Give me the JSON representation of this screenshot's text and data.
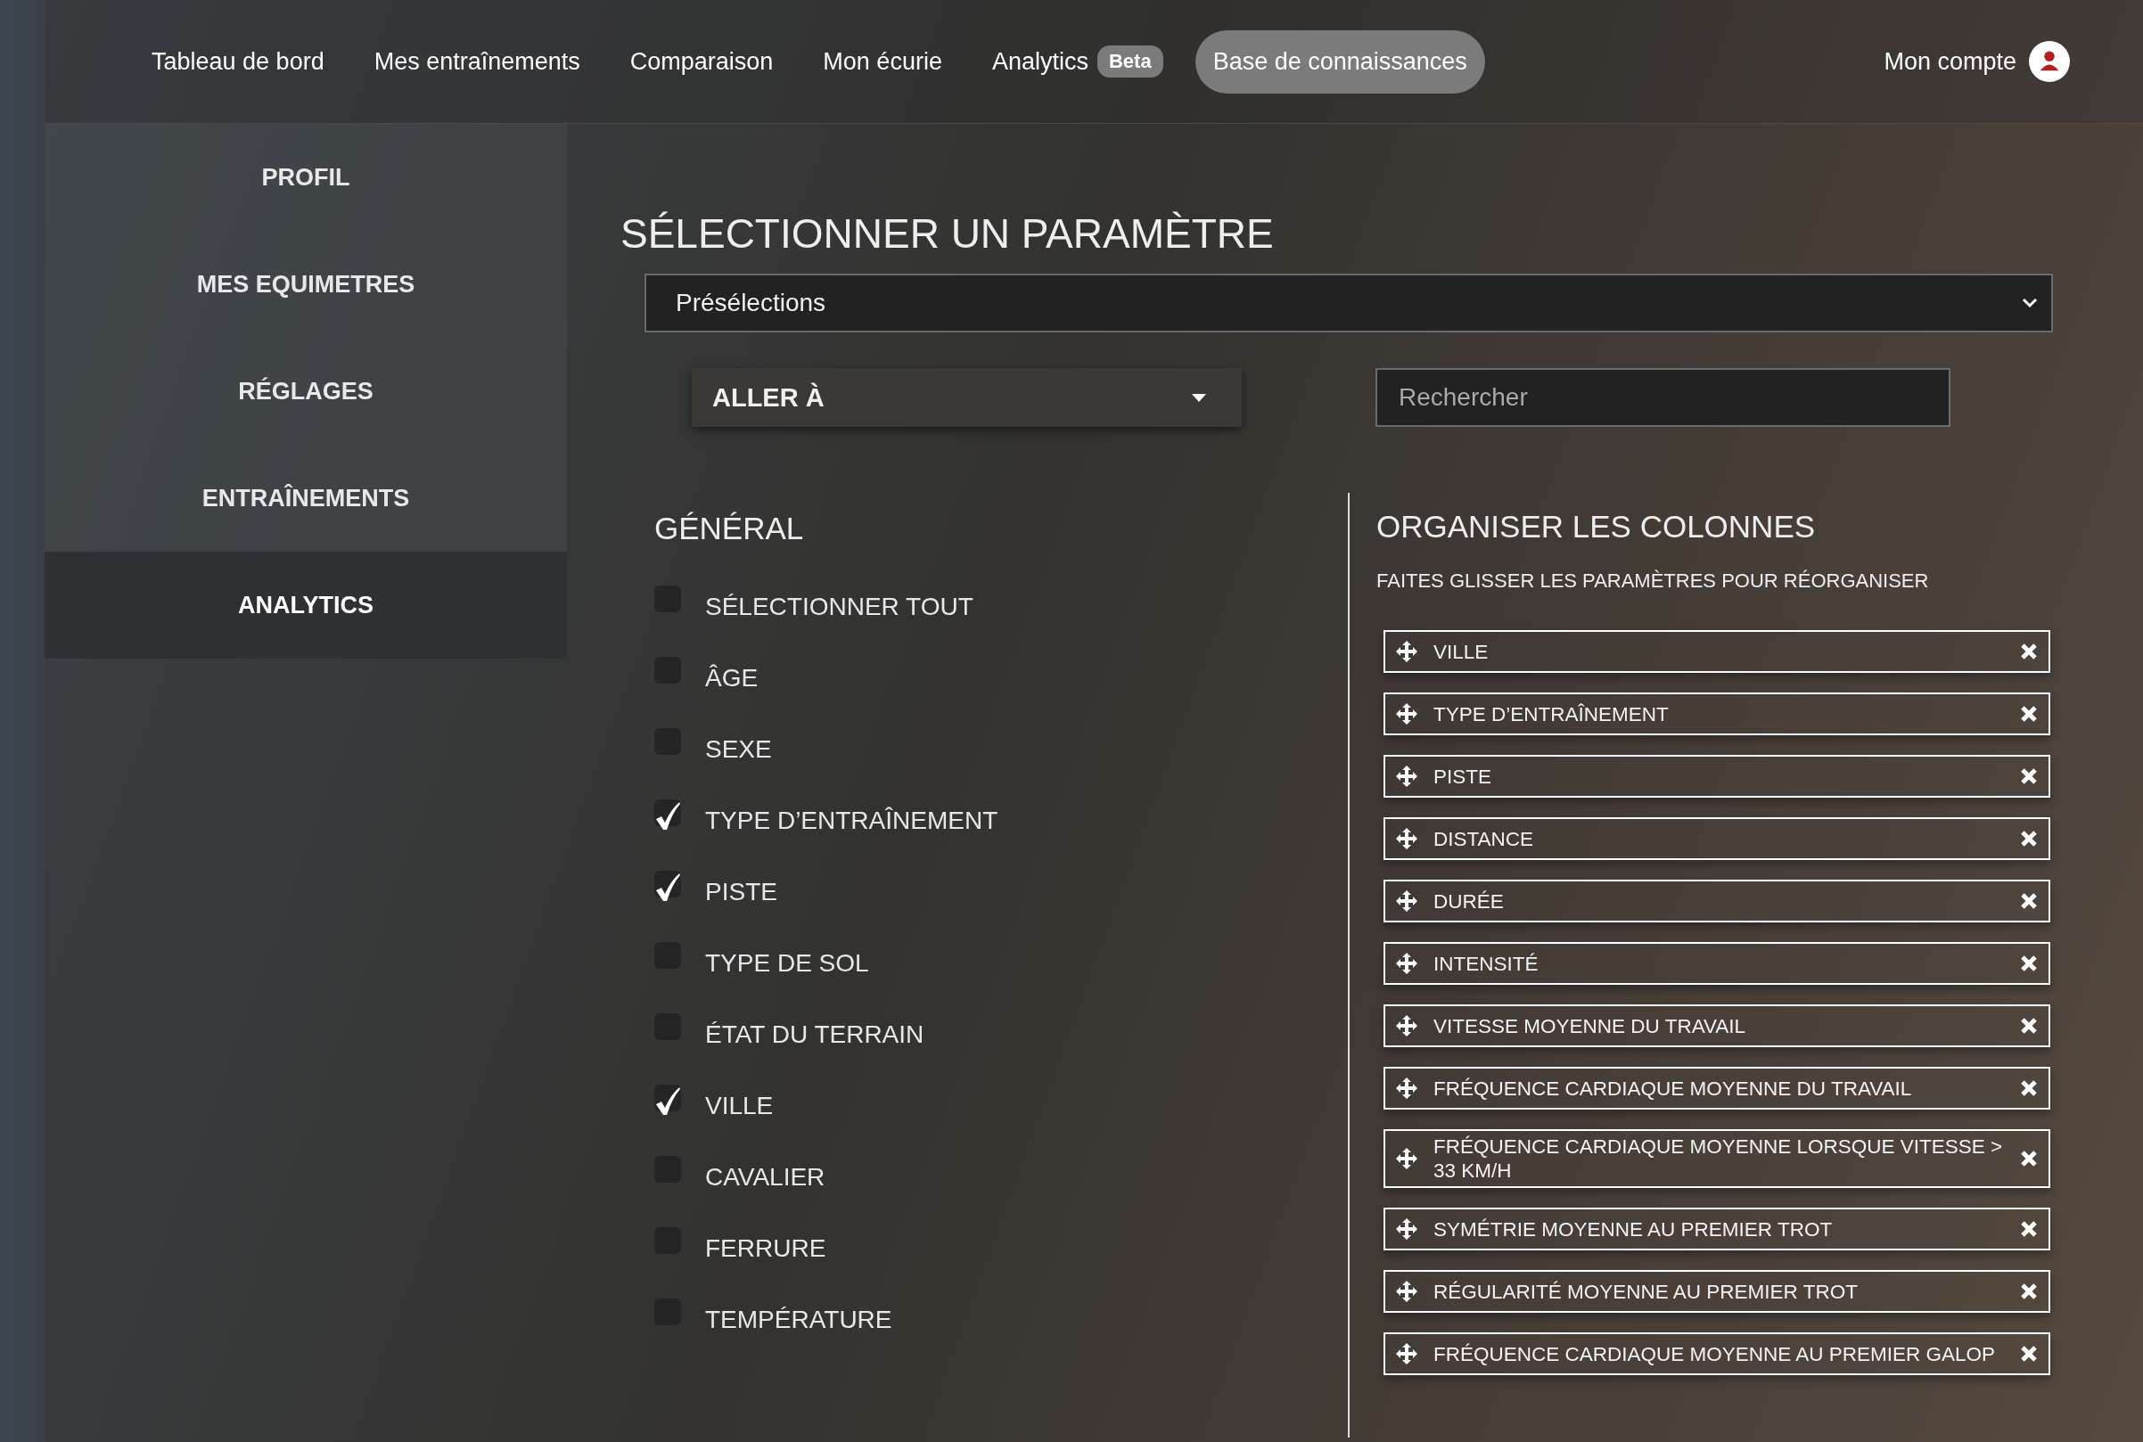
{
  "nav": {
    "items": [
      {
        "label": "Tableau de bord",
        "selected": false
      },
      {
        "label": "Mes entraînements",
        "selected": false
      },
      {
        "label": "Comparaison",
        "selected": false
      },
      {
        "label": "Mon écurie",
        "selected": false
      },
      {
        "label": "Analytics",
        "selected": false,
        "badge": "Beta"
      },
      {
        "label": "Base de connaissances",
        "selected": true
      }
    ],
    "account": {
      "label": "Mon compte"
    }
  },
  "sidebar": {
    "items": [
      {
        "label": "PROFIL",
        "selected": false
      },
      {
        "label": "MES EQUIMETRES",
        "selected": false
      },
      {
        "label": "RÉGLAGES",
        "selected": false
      },
      {
        "label": "ENTRAÎNEMENTS",
        "selected": false
      },
      {
        "label": "ANALYTICS",
        "selected": true
      }
    ]
  },
  "title": "SÉLECTIONNER UN PARAMÈTRE",
  "preset_select": {
    "value": "Présélections"
  },
  "goto_dropdown": {
    "label": "ALLER À"
  },
  "search": {
    "placeholder": "Rechercher"
  },
  "general": {
    "title": "GÉNÉRAL",
    "options": [
      {
        "label": "SÉLECTIONNER TOUT",
        "checked": false
      },
      {
        "label": "ÂGE",
        "checked": false
      },
      {
        "label": "SEXE",
        "checked": false
      },
      {
        "label": "TYPE D’ENTRAÎNEMENT",
        "checked": true
      },
      {
        "label": "PISTE",
        "checked": true
      },
      {
        "label": "TYPE DE SOL",
        "checked": false
      },
      {
        "label": "ÉTAT DU TERRAIN",
        "checked": false
      },
      {
        "label": "VILLE",
        "checked": true
      },
      {
        "label": "CAVALIER",
        "checked": false
      },
      {
        "label": "FERRURE",
        "checked": false
      },
      {
        "label": "TEMPÉRATURE",
        "checked": false
      }
    ]
  },
  "columns": {
    "title": "ORGANISER LES COLONNES",
    "hint": "FAITES GLISSER LES PARAMÈTRES POUR RÉORGANISER",
    "items": [
      "VILLE",
      "TYPE D’ENTRAÎNEMENT",
      "PISTE",
      "DISTANCE",
      "DURÉE",
      "INTENSITÉ",
      "VITESSE MOYENNE DU TRAVAIL",
      "FRÉQUENCE CARDIAQUE MOYENNE DU TRAVAIL",
      "FRÉQUENCE CARDIAQUE MOYENNE LORSQUE VITESSE > 33 KM/H",
      "SYMÉTRIE MOYENNE AU PREMIER TROT",
      "RÉGULARITÉ MOYENNE AU PREMIER TROT",
      "FRÉQUENCE CARDIAQUE MOYENNE AU PREMIER GALOP"
    ]
  }
}
